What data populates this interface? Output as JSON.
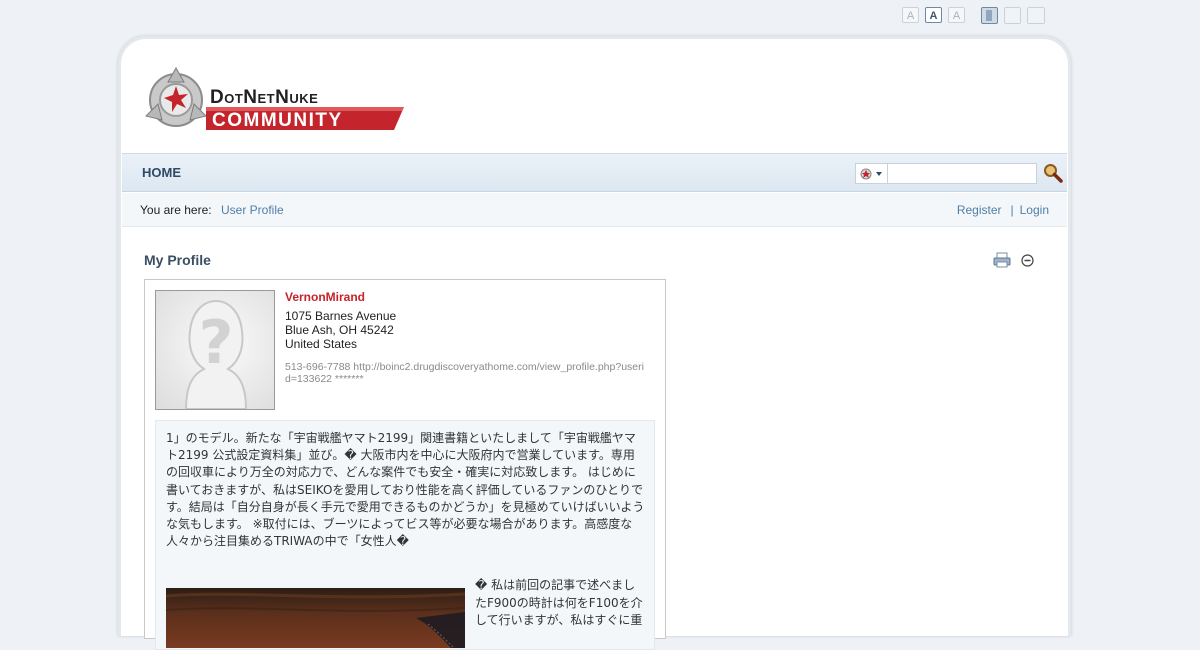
{
  "font_size_controls": [
    "A",
    "A",
    "A"
  ],
  "nav": {
    "home": "HOME"
  },
  "breadcrumb": {
    "label": "You are here:",
    "current": "User Profile"
  },
  "auth": {
    "register": "Register",
    "separator": "|",
    "login": "Login"
  },
  "search": {
    "value": ""
  },
  "module": {
    "title": "My Profile"
  },
  "profile": {
    "username": "VernonMirand",
    "address_line1": "1075 Barnes Avenue",
    "address_line2": "Blue Ash, OH 45242",
    "country": "United States",
    "contact": "513-696-7788 http://boinc2.drugdiscoveryathome.com/view_profile.php?userid=133622 *******",
    "bio": "1」のモデル。新たな「宇宙戦艦ヤマト2199」関連書籍といたしまして「宇宙戦艦ヤマト2199 公式設定資料集」並び。� 大阪市内を中心に大阪府内で営業しています。専用の回収車により万全の対応力で、どんな案件でも安全・確実に対応致します。 はじめに書いておきますが、私はSEIKOを愛用しており性能を高く評価しているファンのひとりです。結局は「自分自身が長く手元で愛用できるものかどうか」を見極めていけばいいような気もします。 ※取付には、ブーツによってビス等が必要な場合があります。高感度な人々から注目集めるTRIWAの中で「女性人�",
    "bio_continued": "� 私は前回の記事で述べましたF900の時計は何をF100を介して行いますが、私はすぐに重"
  },
  "colors": {
    "background": "#eef2f6",
    "nav_text": "#2f4a66",
    "link": "#4f7ea6",
    "username": "#c4242b",
    "logo_red": "#c4242b"
  },
  "logo": {
    "line1": "DotNetNuke",
    "line2": "COMMUNITY"
  }
}
